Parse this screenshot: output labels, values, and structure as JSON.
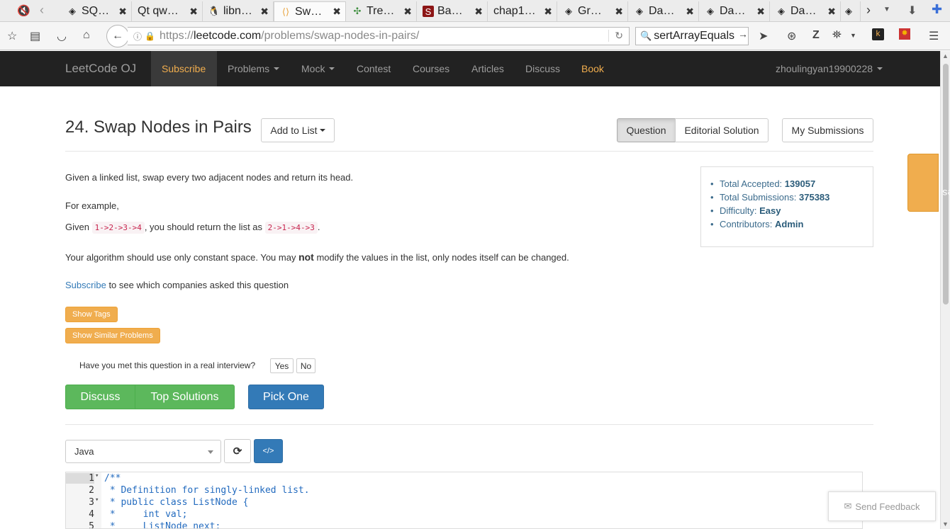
{
  "browser": {
    "tabs": [
      {
        "label": "SQ…",
        "icon": "sql-tab-icon"
      },
      {
        "label": "Qt qw…",
        "icon": "qt-icon"
      },
      {
        "label": "libn…",
        "icon": "linux-icon"
      },
      {
        "label": "Sw…",
        "icon": "leetcode-icon"
      },
      {
        "label": "Tre…",
        "icon": "tree-icon"
      },
      {
        "label": "Ba…",
        "icon": "stanford-icon"
      },
      {
        "label": "chap1…",
        "icon": ""
      },
      {
        "label": "Gr…",
        "icon": "diamond-icon"
      },
      {
        "label": "Da…",
        "icon": "diamond-icon"
      },
      {
        "label": "Da…",
        "icon": "diamond-icon"
      },
      {
        "label": "Da…",
        "icon": "diamond-icon"
      }
    ],
    "close_glyph": "✖",
    "url_scheme": "https://",
    "url_host": "leetcode.com",
    "url_path": "/problems/swap-nodes-in-pairs/",
    "search_value": "sertArrayEquals"
  },
  "site_nav": {
    "brand": "LeetCode OJ",
    "subscribe": "Subscribe",
    "problems": "Problems",
    "mock": "Mock",
    "contest": "Contest",
    "courses": "Courses",
    "articles": "Articles",
    "discuss": "Discuss",
    "book": "Book",
    "user": "zhoulingyan19900228"
  },
  "problem": {
    "title": "24. Swap Nodes in Pairs",
    "add_to_list": "Add to List",
    "tabs": {
      "question": "Question",
      "editorial": "Editorial Solution",
      "submissions": "My Submissions"
    },
    "desc_1": "Given a linked list, swap every two adjacent nodes and return its head.",
    "desc_example": "For example,",
    "given_prefix": "Given",
    "given_code": "1->2->3->4",
    "given_mid": ", you should return the list as",
    "return_code": "2->1->4->3",
    "given_end": ".",
    "space_prefix": "Your algorithm should use only constant space. You may",
    "space_bold": "not",
    "space_suffix": "modify the values in the list, only nodes itself can be changed.",
    "subscribe_link": "Subscribe",
    "subscribe_suffix": "to see which companies asked this question",
    "show_tags": "Show Tags",
    "show_similar": "Show Similar Problems",
    "interview_q": "Have you met this question in a real interview?",
    "yes": "Yes",
    "no": "No",
    "discuss": "Discuss",
    "top_solutions": "Top Solutions",
    "pick_one": "Pick One"
  },
  "stats": {
    "accepted_label": "Total Accepted:",
    "accepted_value": "139057",
    "submissions_label": "Total Submissions:",
    "submissions_value": "375383",
    "difficulty_label": "Difficulty:",
    "difficulty_value": "Easy",
    "contributors_label": "Contributors:",
    "contributors_value": "Admin"
  },
  "notes": "Notes",
  "editor": {
    "language": "Java",
    "lines": [
      {
        "n": "1",
        "fold": "▾",
        "text": "/**"
      },
      {
        "n": "2",
        "fold": "",
        "text": " * Definition for singly-linked list."
      },
      {
        "n": "3",
        "fold": "▾",
        "text": " * public class ListNode {"
      },
      {
        "n": "4",
        "fold": "",
        "text": " *     int val;"
      },
      {
        "n": "5",
        "fold": "",
        "text": " *     ListNode next;"
      }
    ]
  },
  "feedback": "Send Feedback",
  "colors": {
    "accent_orange": "#f0ad4e",
    "navbar_bg": "#222222",
    "green": "#5cb85c",
    "blue": "#337ab7"
  }
}
